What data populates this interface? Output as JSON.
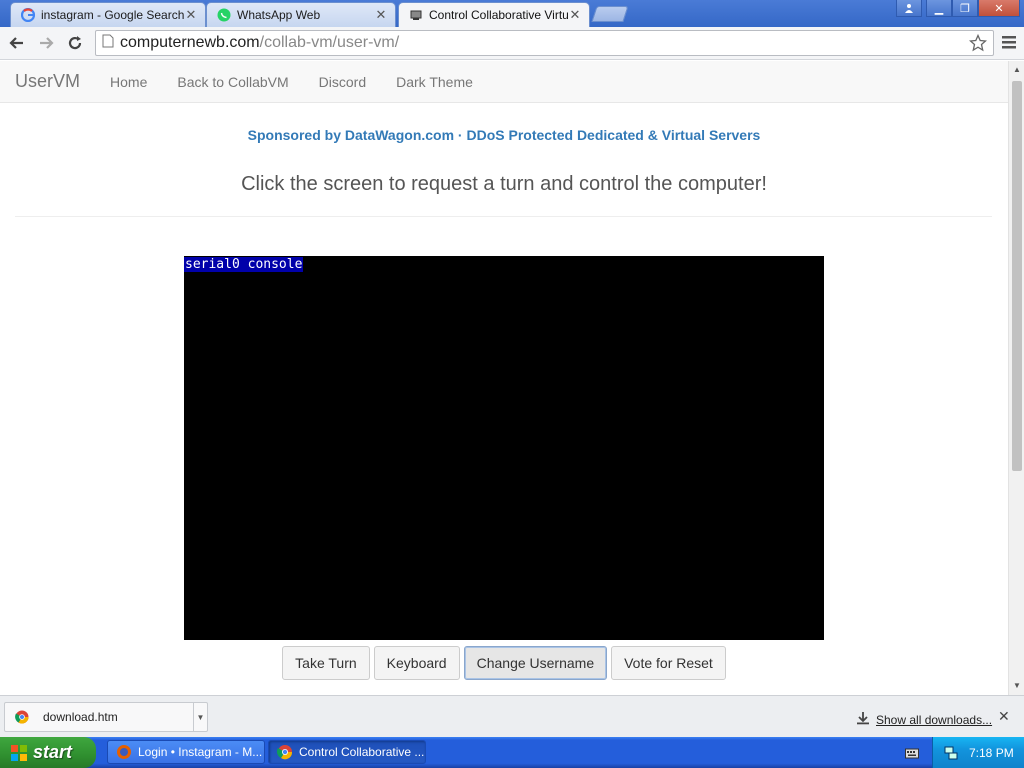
{
  "browser": {
    "tabs": [
      {
        "title": "instagram - Google Search",
        "icon": "google-icon",
        "active": false
      },
      {
        "title": "WhatsApp Web",
        "icon": "whatsapp-icon",
        "active": false
      },
      {
        "title": "Control Collaborative Virtu",
        "icon": "collabvm-icon",
        "active": true
      }
    ],
    "url_domain": "computernewb.com",
    "url_path": "/collab-vm/user-vm/"
  },
  "site": {
    "brand": "UserVM",
    "nav": [
      "Home",
      "Back to CollabVM",
      "Discord",
      "Dark Theme"
    ],
    "sponsor": "Sponsored by DataWagon.com · DDoS Protected Dedicated & Virtual Servers",
    "lead": "Click the screen to request a turn and control the computer!",
    "vm_console_label": "serial0 console",
    "buttons": {
      "take_turn": "Take Turn",
      "keyboard": "Keyboard",
      "change_username": "Change Username",
      "vote_reset": "Vote for Reset"
    }
  },
  "downloads": {
    "item": "download.htm",
    "show_all": "Show all downloads..."
  },
  "taskbar": {
    "start": "start",
    "tasks": [
      {
        "title": "Login • Instagram - M...",
        "active": false
      },
      {
        "title": "Control Collaborative ...",
        "active": true
      }
    ],
    "clock": "7:18 PM"
  },
  "colors": {
    "link_blue": "#337ab7",
    "xp_taskbar": "#245edb",
    "start_green": "#2f8f2f",
    "vm_background": "#000000",
    "console_label_bg": "#0000aa"
  }
}
